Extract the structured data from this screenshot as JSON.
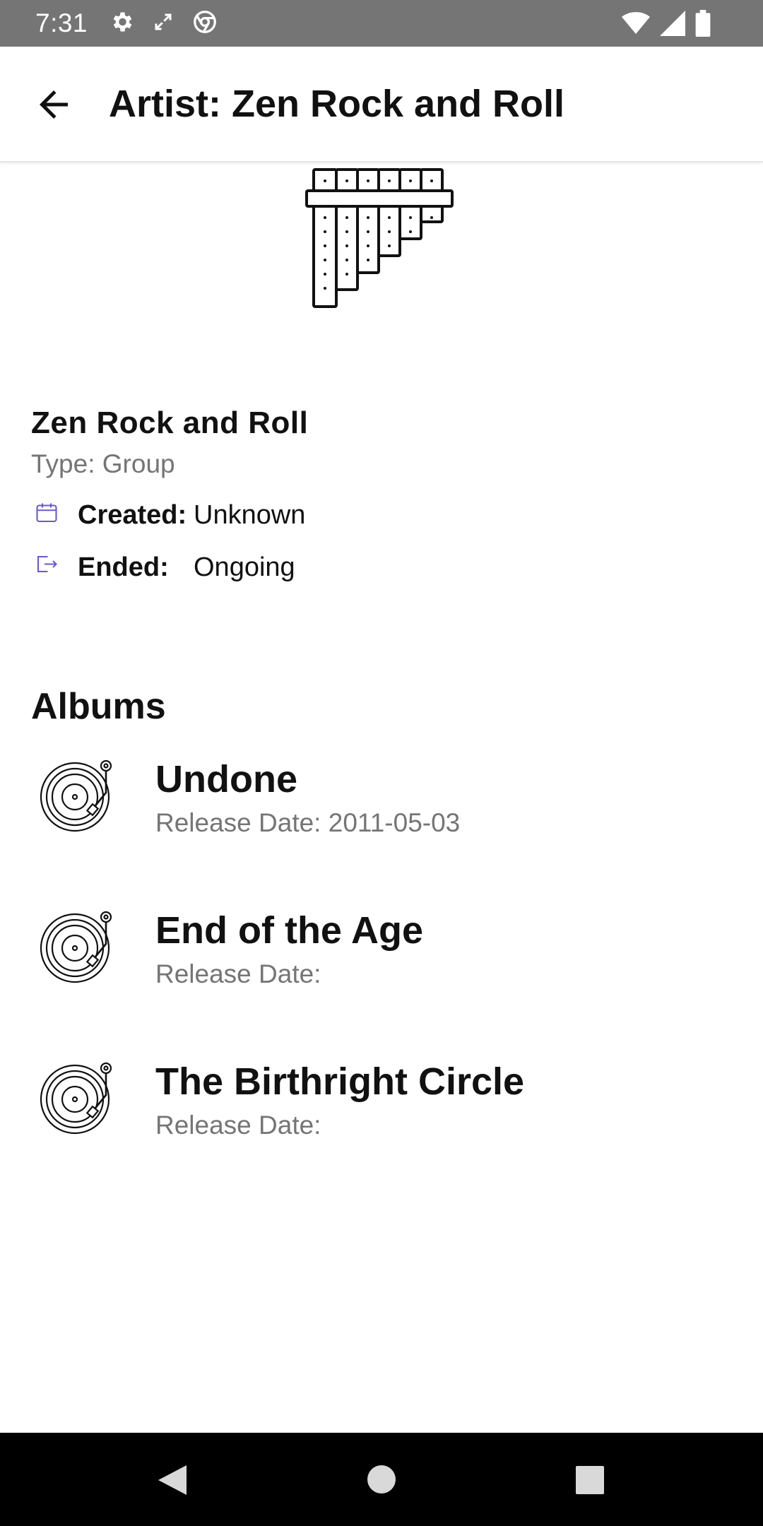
{
  "status_bar": {
    "time": "7:31",
    "icons": [
      "gear-icon",
      "expand-icon",
      "chrome-icon",
      "wifi-icon",
      "signal-icon",
      "battery-icon"
    ]
  },
  "app_bar": {
    "title": "Artist: Zen Rock and Roll",
    "back_icon": "arrow-left-icon"
  },
  "artist": {
    "image_icon": "pan-flute-icon",
    "name": "Zen Rock and Roll",
    "type": "Type: Group",
    "created_label": "Created:",
    "created_value": "Unknown",
    "ended_label": "Ended:",
    "ended_value": "Ongoing"
  },
  "albums_section": {
    "title": "Albums",
    "items": [
      {
        "title": "Undone",
        "release": "Release Date: 2011-05-03"
      },
      {
        "title": "End of the Age",
        "release": "Release Date:"
      },
      {
        "title": "The Birthright Circle",
        "release": "Release Date:"
      }
    ]
  },
  "colors": {
    "status_bar_bg": "#757575",
    "secondary_text": "#757575",
    "accent_icon": "#6a5acd",
    "nav_bar_bg": "#000000"
  }
}
